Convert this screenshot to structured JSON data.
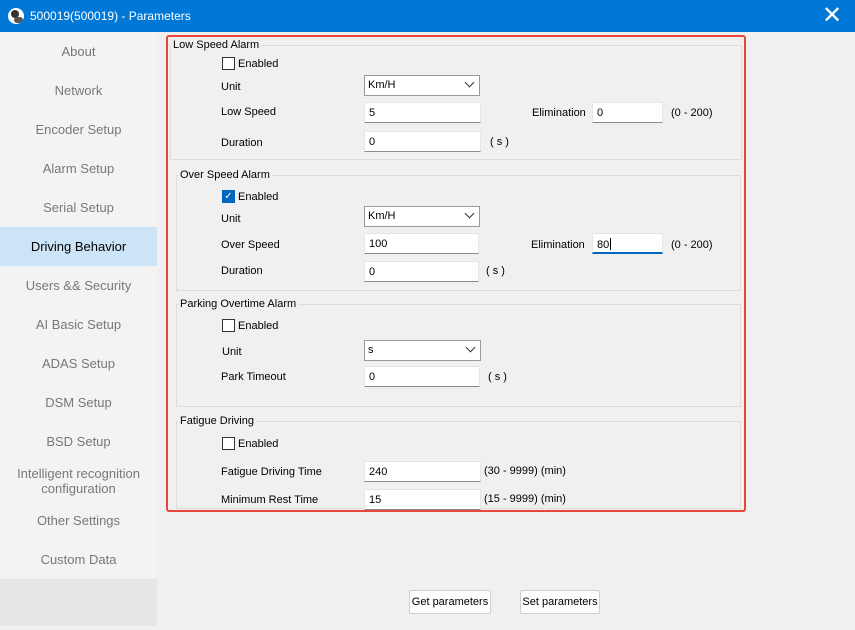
{
  "window": {
    "title": "500019(500019) - Parameters"
  },
  "sidebar": {
    "items": [
      {
        "label": "About"
      },
      {
        "label": "Network"
      },
      {
        "label": "Encoder Setup"
      },
      {
        "label": "Alarm Setup"
      },
      {
        "label": "Serial Setup"
      },
      {
        "label": "Driving Behavior",
        "active": true
      },
      {
        "label": "Users && Security"
      },
      {
        "label": "AI Basic Setup"
      },
      {
        "label": "ADAS Setup"
      },
      {
        "label": "DSM Setup"
      },
      {
        "label": "BSD Setup"
      },
      {
        "label": "Intelligent recognition\nconfiguration"
      },
      {
        "label": "Other Settings"
      },
      {
        "label": "Custom Data"
      }
    ]
  },
  "low_speed": {
    "title": "Low Speed Alarm",
    "enabled_label": "Enabled",
    "enabled": false,
    "unit_label": "Unit",
    "unit_value": "Km/H",
    "speed_label": "Low Speed",
    "speed_value": "5",
    "duration_label": "Duration",
    "duration_value": "0",
    "duration_unit": "( s )",
    "elimination_label": "Elimination",
    "elimination_value": "0",
    "elimination_range": "(0 - 200)"
  },
  "over_speed": {
    "title": "Over Speed Alarm",
    "enabled_label": "Enabled",
    "enabled": true,
    "unit_label": "Unit",
    "unit_value": "Km/H",
    "speed_label": "Over Speed",
    "speed_value": "100",
    "duration_label": "Duration",
    "duration_value": "0",
    "duration_unit": "( s )",
    "elimination_label": "Elimination",
    "elimination_value": "80",
    "elimination_range": "(0 - 200)"
  },
  "parking": {
    "title": "Parking Overtime Alarm",
    "enabled_label": "Enabled",
    "enabled": false,
    "unit_label": "Unit",
    "unit_value": "s",
    "timeout_label": "Park Timeout",
    "timeout_value": "0",
    "timeout_unit": "( s )"
  },
  "fatigue": {
    "title": "Fatigue Driving",
    "enabled_label": "Enabled",
    "enabled": false,
    "time_label": "Fatigue Driving Time",
    "time_value": "240",
    "time_range": "(30 - 9999)  (min)",
    "rest_label": "Minimum Rest Time",
    "rest_value": "15",
    "rest_range": "(15 - 9999)  (min)"
  },
  "buttons": {
    "get": "Get parameters",
    "set": "Set parameters"
  }
}
